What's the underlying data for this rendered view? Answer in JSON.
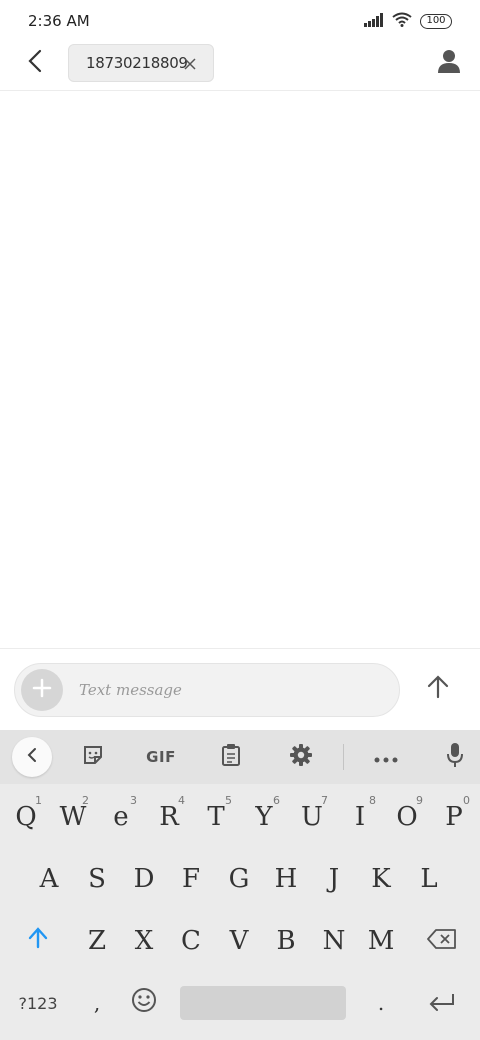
{
  "status_bar": {
    "time": "2:36 AM",
    "battery": "100"
  },
  "header": {
    "recipient": "18730218809"
  },
  "compose": {
    "placeholder": "Text message"
  },
  "keyboard": {
    "toolbar": {
      "gif_label": "GIF"
    },
    "rows": [
      [
        {
          "label": "Q",
          "hint": "1"
        },
        {
          "label": "W",
          "hint": "2"
        },
        {
          "label": "e",
          "hint": "3"
        },
        {
          "label": "R",
          "hint": "4"
        },
        {
          "label": "T",
          "hint": "5"
        },
        {
          "label": "Y",
          "hint": "6"
        },
        {
          "label": "U",
          "hint": "7"
        },
        {
          "label": "I",
          "hint": "8"
        },
        {
          "label": "O",
          "hint": "9"
        },
        {
          "label": "P",
          "hint": "0"
        }
      ],
      [
        "A",
        "S",
        "D",
        "F",
        "G",
        "H",
        "J",
        "K",
        "L"
      ],
      [
        "Z",
        "X",
        "C",
        "V",
        "B",
        "N",
        "M"
      ]
    ],
    "symbols_label": "?123",
    "comma": ",",
    "period": "."
  },
  "colors": {
    "shift_accent": "#2196f3",
    "keyboard_bg": "#ebebeb",
    "toolbar_bg": "#e3e3e3"
  },
  "icons": {
    "back": "chevron-left-icon",
    "chip_close": "close-icon",
    "contact": "person-icon",
    "attach": "plus-icon",
    "send": "arrow-up-icon",
    "collapse": "chevron-left-icon",
    "sticker": "sticker-icon",
    "clipboard": "clipboard-icon",
    "settings": "gear-icon",
    "more": "more-horizontal-icon",
    "mic": "microphone-icon",
    "shift": "shift-icon",
    "backspace": "backspace-icon",
    "emoji": "emoji-icon",
    "enter": "enter-icon"
  }
}
